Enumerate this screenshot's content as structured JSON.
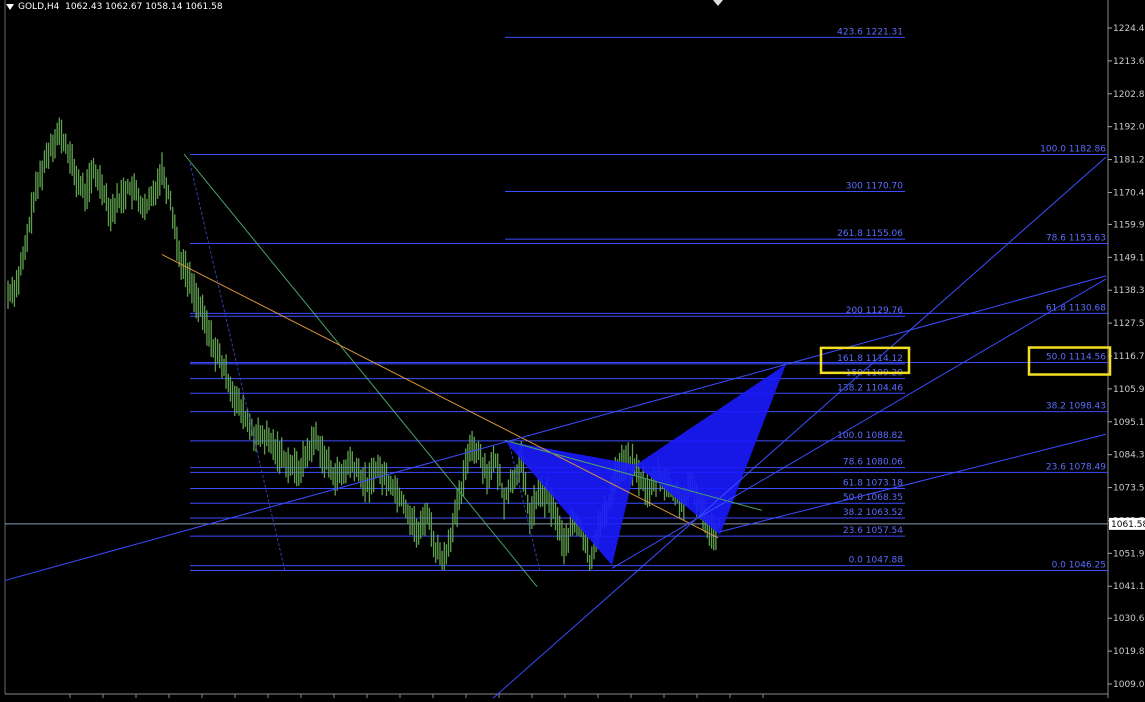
{
  "header": {
    "symbol": "GOLD,H4",
    "ohlc": "1062.43 1062.67 1058.14 1061.58"
  },
  "colors": {
    "background": "#000000",
    "candles": "#5fa04e",
    "fib_lines": "#3c4dff",
    "fib_labels": "#5a6cff",
    "harmonic_fill": "#1a1aff",
    "trend_green": "#4a9f6a",
    "trend_orange": "#d8953a",
    "axis_text": "#cccccc",
    "highlight_box": "#f4e021",
    "price_line": "#8899bb"
  },
  "chart_data": {
    "type": "candlestick",
    "symbol": "GOLD",
    "timeframe": "H4",
    "current_price": "1061.58",
    "y_ticks": [
      "1224.40",
      "1213.60",
      "1202.80",
      "1192.00",
      "1181.20",
      "1170.40",
      "1159.90",
      "1149.10",
      "1138.30",
      "1127.50",
      "1116.70",
      "1105.90",
      "1095.10",
      "1084.30",
      "1073.50",
      "1062.70",
      "1051.90",
      "1041.10",
      "1030.60",
      "1019.80",
      "1009.00"
    ],
    "ylim": [
      1005,
      1232
    ],
    "close_path": [
      1137,
      1140,
      1151,
      1168,
      1178,
      1186,
      1190,
      1184,
      1175,
      1170,
      1177,
      1173,
      1164,
      1168,
      1172,
      1170,
      1164,
      1170,
      1178,
      1168,
      1150,
      1143,
      1136,
      1128,
      1120,
      1114,
      1107,
      1100,
      1095,
      1090,
      1090,
      1087,
      1084,
      1081,
      1079,
      1085,
      1090,
      1083,
      1078,
      1077,
      1082,
      1078,
      1074,
      1080,
      1077,
      1074,
      1070,
      1064,
      1058,
      1066,
      1053,
      1050,
      1061,
      1072,
      1088,
      1085,
      1078,
      1082,
      1070,
      1076,
      1082,
      1064,
      1071,
      1070,
      1065,
      1054,
      1062,
      1060,
      1049,
      1060,
      1066,
      1078,
      1082,
      1081,
      1076,
      1072,
      1078,
      1075,
      1071,
      1069,
      1074,
      1067,
      1061,
      1058
    ],
    "fib_left": [
      {
        "label": "423.6 1221.31",
        "price": 1221.31
      },
      {
        "label": "300 1170.70",
        "price": 1170.7
      },
      {
        "label": "261.8 1155.06",
        "price": 1155.06
      },
      {
        "label": "200 1129.76",
        "price": 1129.76
      },
      {
        "label": "161.8 1114.12",
        "price": 1114.12
      },
      {
        "label": "150 1109.29",
        "price": 1109.29
      },
      {
        "label": "138.2 1104.46",
        "price": 1104.46
      },
      {
        "label": "100.0 1088.82",
        "price": 1088.82
      },
      {
        "label": "78.6 1080.06",
        "price": 1080.06
      },
      {
        "label": "61.8 1073.18",
        "price": 1073.18
      },
      {
        "label": "50.0 1068.35",
        "price": 1068.35
      },
      {
        "label": "38.2 1063.52",
        "price": 1063.52
      },
      {
        "label": "23.6 1057.54",
        "price": 1057.54
      },
      {
        "label": "0.0 1047.88",
        "price": 1047.88
      }
    ],
    "fib_right": [
      {
        "label": "100.0 1182.86",
        "price": 1182.86
      },
      {
        "label": "78.6 1153.63",
        "price": 1153.63
      },
      {
        "label": "61.8 1130.68",
        "price": 1130.68
      },
      {
        "label": "50.0 1114.56",
        "price": 1114.56
      },
      {
        "label": "38.2 1098.43",
        "price": 1098.43
      },
      {
        "label": "23.6 1078.49",
        "price": 1078.49
      },
      {
        "label": "0.0 1046.25",
        "price": 1046.25
      }
    ]
  }
}
